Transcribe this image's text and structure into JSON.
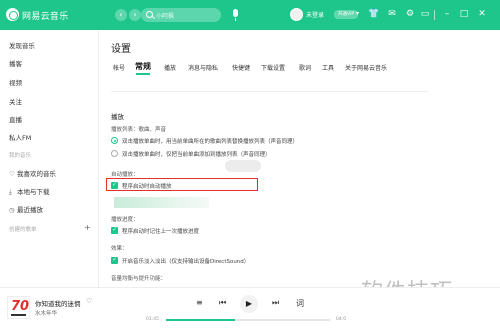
{
  "app": {
    "title": "网易云音乐"
  },
  "topbar": {
    "back": "‹",
    "forward": "›",
    "search_placeholder": "小阿枫",
    "user": "未登录",
    "vip": "开通VIP",
    "caret": "▾",
    "accent": "#1ec68c"
  },
  "sidebar": {
    "items": [
      "发现音乐",
      "播客",
      "视频",
      "关注",
      "直播",
      "私人FM"
    ],
    "my_music_header": "我的音乐",
    "my_music": [
      "我喜欢的音乐",
      "本地与下载",
      "最近播放"
    ],
    "created_header": "创建的歌单"
  },
  "settings": {
    "title": "设置",
    "tabs": [
      "帐号",
      "常规",
      "播放",
      "消息与隐私",
      "快捷键",
      "下载设置",
      "歌词",
      "工具",
      "关于网易云音乐"
    ],
    "active_tab": "常规",
    "play_section": {
      "title": "播放",
      "list_label": "播放列表：歌曲、声音",
      "options": [
        {
          "text": "双击播放单曲时，用当前单曲所在的歌曲列表替换播放列表（声音同理）",
          "selected": true
        },
        {
          "text": "双击播放单曲时，仅把当前单曲添加到播放列表（声音同理）",
          "selected": false
        }
      ]
    },
    "autoplay": {
      "label": "自动播放：",
      "option": "程序启动时自动播放",
      "checked": true
    },
    "progress": {
      "label": "播放进度：",
      "option": "程序启动时记住上一次播放进度",
      "checked": true
    },
    "effects": {
      "label": "效果：",
      "option": "开启音乐淡入淡出（仅支持输出设备DirectSound）",
      "checked": true
    },
    "audio_focus": {
      "label": "音量均衡与提升功能：",
      "option": "开启后可让音量保持一致",
      "checked": false
    }
  },
  "player": {
    "song_title": "你知道我的迷惘",
    "artist": "水木年华",
    "time_current": "01:45",
    "time_total": "04:0",
    "progress": 0.42,
    "cover_text": "70"
  },
  "watermark": "软件技巧"
}
